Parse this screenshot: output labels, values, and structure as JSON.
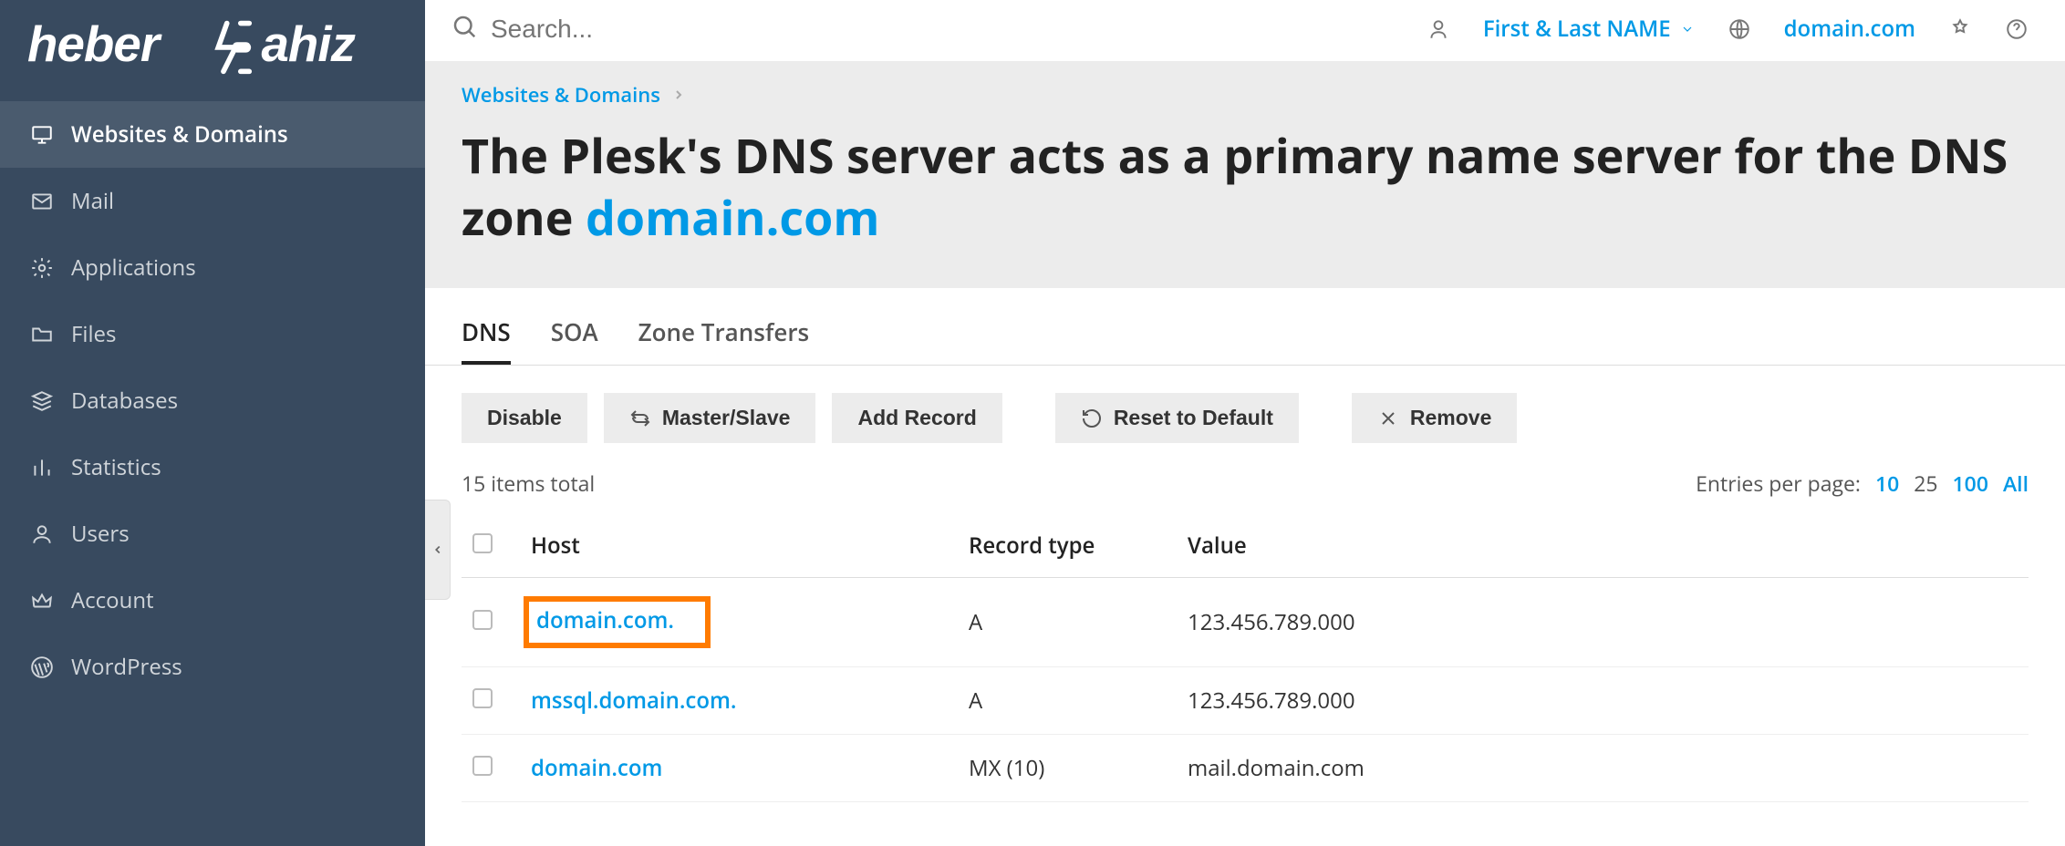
{
  "brand": "heberjahiz",
  "sidebar": {
    "items": [
      {
        "label": "Websites & Domains",
        "icon": "monitor",
        "active": true
      },
      {
        "label": "Mail",
        "icon": "envelope",
        "active": false
      },
      {
        "label": "Applications",
        "icon": "gear",
        "active": false
      },
      {
        "label": "Files",
        "icon": "folder",
        "active": false
      },
      {
        "label": "Databases",
        "icon": "layers",
        "active": false
      },
      {
        "label": "Statistics",
        "icon": "bar-chart",
        "active": false
      },
      {
        "label": "Users",
        "icon": "user",
        "active": false
      },
      {
        "label": "Account",
        "icon": "crown",
        "active": false
      },
      {
        "label": "WordPress",
        "icon": "wordpress",
        "active": false
      }
    ]
  },
  "search": {
    "placeholder": "Search..."
  },
  "user": {
    "name": "First & Last NAME",
    "domain": "domain.com"
  },
  "breadcrumb": {
    "root": "Websites & Domains"
  },
  "title": {
    "prefix": "The Plesk's DNS server acts as a primary name server for the DNS zone ",
    "domain": "domain.com"
  },
  "tabs": [
    {
      "label": "DNS",
      "active": true
    },
    {
      "label": "SOA",
      "active": false
    },
    {
      "label": "Zone Transfers",
      "active": false
    }
  ],
  "actions": {
    "disable": "Disable",
    "master_slave": "Master/Slave",
    "add_record": "Add Record",
    "reset_default": "Reset to Default",
    "remove": "Remove"
  },
  "meta": {
    "items_total": "15 items total",
    "entries_label": "Entries per page:",
    "pager": {
      "p10": "10",
      "p25": "25",
      "p100": "100",
      "all": "All"
    }
  },
  "table": {
    "headers": {
      "host": "Host",
      "type": "Record type",
      "value": "Value"
    },
    "rows": [
      {
        "host": "domain.com.",
        "type": "A",
        "value": "123.456.789.000",
        "highlight": true
      },
      {
        "host": "mssql.domain.com.",
        "type": "A",
        "value": "123.456.789.000",
        "highlight": false
      },
      {
        "host": "domain.com",
        "type": "MX (10)",
        "value": "mail.domain.com",
        "highlight": false
      }
    ]
  }
}
